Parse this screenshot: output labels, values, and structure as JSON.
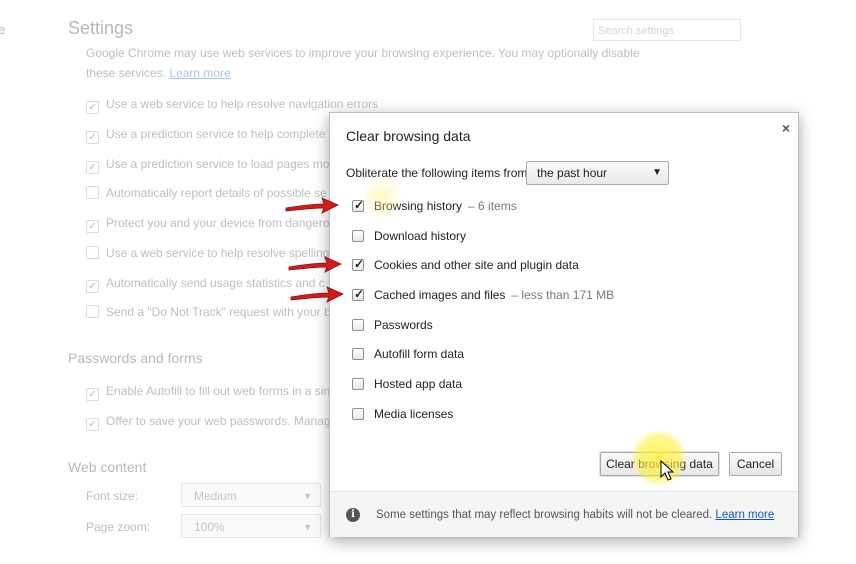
{
  "background": {
    "left_edge_char": "e",
    "title": "Settings",
    "search_placeholder": "Search settings",
    "intro": "Google Chrome may use web services to improve your browsing experience. You may optionally disable these services.",
    "intro_link": "Learn more",
    "privacy_items": [
      {
        "label": "Use a web service to help resolve navigation errors",
        "checked": true
      },
      {
        "label": "Use a prediction service to help complete sea",
        "checked": true
      },
      {
        "label": "Use a prediction service to load pages more",
        "checked": true
      },
      {
        "label": "Automatically report details of possible se",
        "checked": false
      },
      {
        "label": "Protect you and your device from dangerou",
        "checked": true
      },
      {
        "label": "Use a web service to help resolve spelling",
        "checked": false
      },
      {
        "label": "Automatically send usage statistics and c",
        "checked": true
      },
      {
        "label": "Send a \"Do Not Track\" request with your bro",
        "checked": false
      }
    ],
    "passwords_section": "Passwords and forms",
    "password_items": [
      {
        "label": "Enable Autofill to fill out web forms in a singl",
        "checked": true
      },
      {
        "label": "Offer to save your web passwords. Manage p",
        "checked": true
      }
    ],
    "web_content_section": "Web content",
    "font_size_label": "Font size:",
    "font_size_value": "Medium",
    "page_zoom_label": "Page zoom:",
    "page_zoom_value": "100%"
  },
  "dialog": {
    "title": "Clear browsing data",
    "close_symbol": "×",
    "obliterate_label": "Obliterate the following items from:",
    "time_period": "the past hour",
    "items": [
      {
        "label": "Browsing history",
        "detail": "–  6 items",
        "checked": true
      },
      {
        "label": "Download history",
        "detail": "",
        "checked": false
      },
      {
        "label": "Cookies and other site and plugin data",
        "detail": "",
        "checked": true
      },
      {
        "label": "Cached images and files",
        "detail": "–  less than 171 MB",
        "checked": true
      },
      {
        "label": "Passwords",
        "detail": "",
        "checked": false
      },
      {
        "label": "Autofill form data",
        "detail": "",
        "checked": false
      },
      {
        "label": "Hosted app data",
        "detail": "",
        "checked": false
      },
      {
        "label": "Media licenses",
        "detail": "",
        "checked": false
      }
    ],
    "clear_button": "Clear browsing data",
    "cancel_button": "Cancel",
    "footer_text": "Some settings that may reflect browsing habits will not be cleared.",
    "footer_link": "Learn more"
  },
  "colors": {
    "annotation_arrow": "#d41b1b",
    "click_highlight": "#fff03c",
    "link": "#1155cc"
  }
}
